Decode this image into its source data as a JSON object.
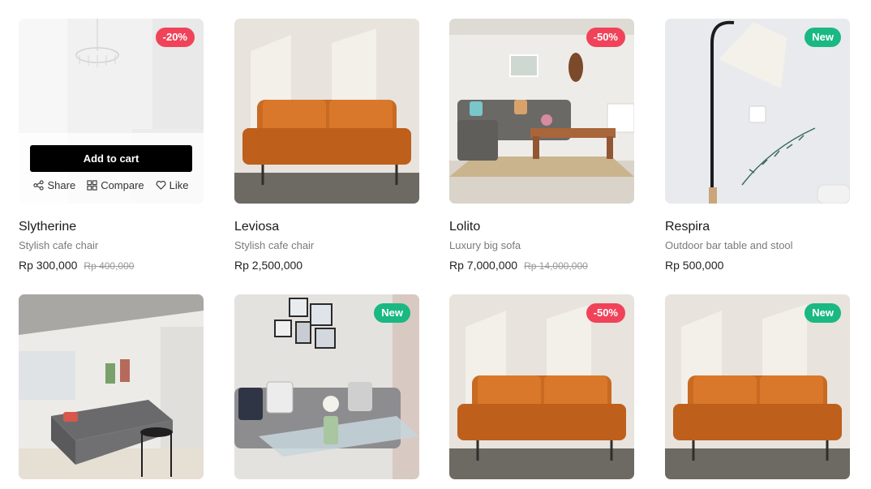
{
  "products": [
    {
      "name": "Slytherine",
      "desc": "Stylish cafe chair",
      "price": "Rp 300,000",
      "old_price": "Rp 400,000",
      "badge": "-20%",
      "badge_type": "sale",
      "image": "white-room-chandelier"
    },
    {
      "name": "Leviosa",
      "desc": "Stylish cafe chair",
      "price": "Rp 2,500,000",
      "old_price": "",
      "badge": "",
      "badge_type": "",
      "image": "orange-leather-sofa"
    },
    {
      "name": "Lolito",
      "desc": "Luxury big sofa",
      "price": "Rp 7,000,000",
      "old_price": "Rp 14,000,000",
      "badge": "-50%",
      "badge_type": "sale",
      "image": "grey-living-room"
    },
    {
      "name": "Respira",
      "desc": "Outdoor bar table and stool",
      "price": "Rp 500,000",
      "old_price": "",
      "badge": "New",
      "badge_type": "new",
      "image": "floor-lamp"
    },
    {
      "name": "",
      "desc": "",
      "price": "",
      "old_price": "",
      "badge": "",
      "badge_type": "",
      "image": "grey-sofa-loft"
    },
    {
      "name": "",
      "desc": "",
      "price": "",
      "old_price": "",
      "badge": "New",
      "badge_type": "new",
      "image": "sofa-glass-table"
    },
    {
      "name": "",
      "desc": "",
      "price": "",
      "old_price": "",
      "badge": "-50%",
      "badge_type": "sale",
      "image": "orange-leather-sofa"
    },
    {
      "name": "",
      "desc": "",
      "price": "",
      "old_price": "",
      "badge": "New",
      "badge_type": "new",
      "image": "orange-leather-sofa"
    }
  ],
  "hover_card": {
    "add_to_cart": "Add to cart",
    "share": "Share",
    "compare": "Compare",
    "like": "Like"
  },
  "colors": {
    "sale_badge": "#f0435a",
    "new_badge": "#1ab883",
    "button": "#000000"
  }
}
